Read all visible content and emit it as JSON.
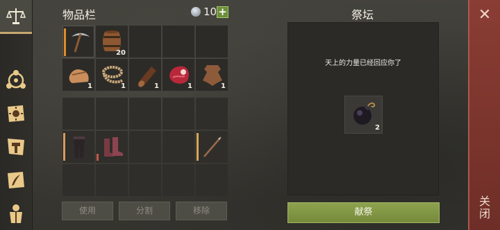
{
  "sidebar": {
    "icons": [
      "scales-icon",
      "circle-nodes-icon",
      "sun-book-icon",
      "hammer-map-icon",
      "quill-scroll-icon",
      "armor-icon"
    ]
  },
  "inventory": {
    "title": "物品栏",
    "coins": "10",
    "add_label": "+",
    "rows": [
      [
        {
          "icon": "pickaxe-icon",
          "qty": "",
          "bar": "#e08c2a"
        },
        {
          "icon": "barrel-icon",
          "qty": "20"
        },
        {},
        {},
        {}
      ],
      [
        {
          "icon": "leather-scrap-icon",
          "qty": "1"
        },
        {
          "icon": "rope-icon",
          "qty": "1"
        },
        {
          "icon": "log-icon",
          "qty": "1"
        },
        {
          "icon": "raw-meat-icon",
          "qty": "1"
        },
        {
          "icon": "hide-icon",
          "qty": "1"
        }
      ]
    ],
    "lower_rows": [
      [
        {},
        {},
        {},
        {},
        {}
      ],
      [
        {
          "icon": "leggings-icon",
          "bar": "#d79a5a"
        },
        {
          "icon": "boots-icon",
          "bar": "#c45a4a"
        },
        {},
        {},
        {
          "icon": "spear-icon",
          "bar": "#d9a65a"
        }
      ],
      [
        {},
        {},
        {},
        {},
        {}
      ]
    ],
    "buttons": {
      "use": "使用",
      "split": "分割",
      "remove": "移除"
    }
  },
  "altar": {
    "title": "祭坛",
    "message": "天上的力量已经回应你了",
    "slot": {
      "icon": "bomb-icon",
      "qty": "2"
    },
    "offer_label": "献祭"
  },
  "close": {
    "label": "关闭"
  }
}
